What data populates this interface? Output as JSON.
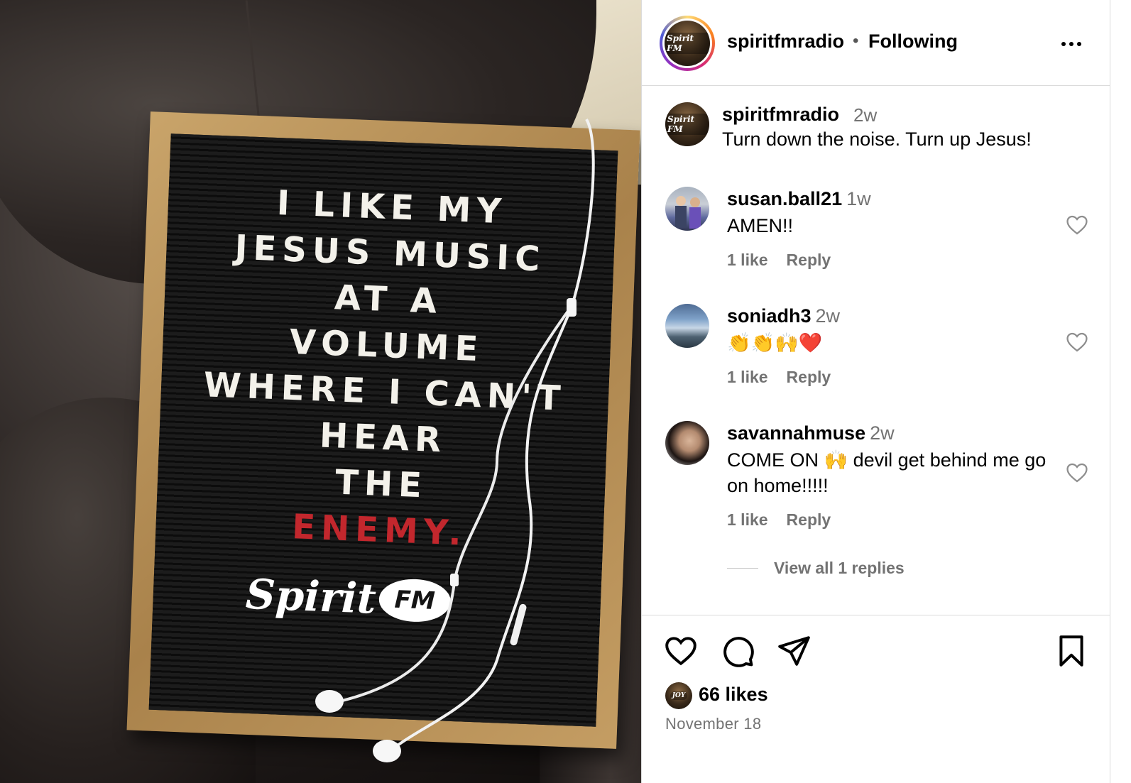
{
  "post_image": {
    "board_lines": [
      "I LIKE MY",
      "JESUS MUSIC",
      "AT A",
      "VOLUME",
      "WHERE I CAN'T",
      "HEAR",
      "THE"
    ],
    "board_highlight": "ENEMY.",
    "logo_text": "Spirit",
    "logo_badge": "FM"
  },
  "header": {
    "username": "spiritfmradio",
    "separator": "•",
    "follow_status": "Following",
    "avatar_label": "Spirit FM"
  },
  "caption": {
    "username": "spiritfmradio",
    "time": "2w",
    "text": "Turn down the noise. Turn up Jesus!"
  },
  "comments": [
    {
      "username": "susan.ball21",
      "time": "1w",
      "text": "AMEN!!",
      "likes": "1 like",
      "reply": "Reply"
    },
    {
      "username": "soniadh3",
      "time": "2w",
      "text": "👏👏🙌❤️",
      "likes": "1 like",
      "reply": "Reply"
    },
    {
      "username": "savannahmuse",
      "time": "2w",
      "text": "COME ON 🙌 devil get behind me go on home!!!!!",
      "likes": "1 like",
      "reply": "Reply"
    }
  ],
  "view_replies": "View all 1 replies",
  "actions": {
    "likes_avatar_label": "JOY",
    "likes": "66 likes",
    "date": "November 18"
  },
  "icons": {
    "more": "more-horizontal-icon",
    "heart": "heart-icon",
    "comment": "comment-icon",
    "share": "share-icon",
    "save": "bookmark-icon"
  }
}
